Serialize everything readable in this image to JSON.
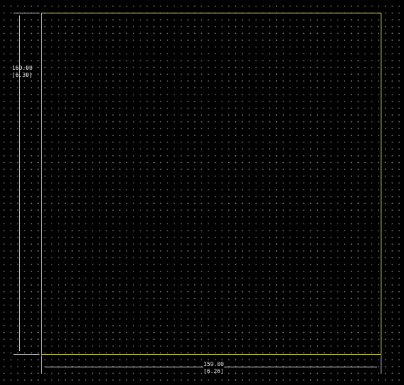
{
  "board": {
    "outline_color": "#e8e84a",
    "background_color": "#000000",
    "grid_color": "#9a9a9a"
  },
  "dimensions": {
    "height": {
      "value": "160.00",
      "inches": "[6.30]"
    },
    "width": {
      "value": "159.00",
      "inches": "[6.26]"
    }
  }
}
